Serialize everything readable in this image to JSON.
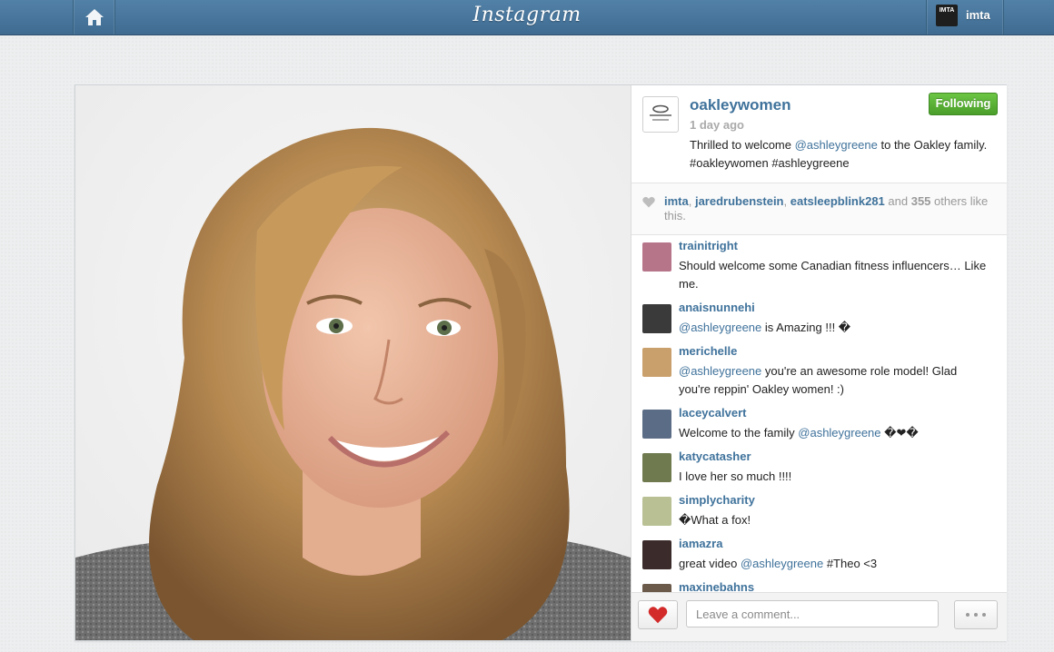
{
  "header": {
    "logo_text": "Instagram",
    "user": {
      "name": "imta",
      "avatar_text": "IMTA"
    },
    "home_icon": "home-icon"
  },
  "post": {
    "owner": {
      "username": "oakleywomen",
      "avatar_text": "oakley women"
    },
    "follow_label": "Following",
    "time_ago": "1 day ago",
    "caption": {
      "before": "Thrilled to welcome ",
      "mention": "@ashleygreene",
      "after": " to the Oakley family. #oakleywomen #ashleygreene"
    },
    "likes": {
      "users": [
        "imta",
        "jaredrubenstein",
        "eatsleepblink281"
      ],
      "sep": ", ",
      "and_text": " and ",
      "count": "355",
      "suffix": " others like this."
    }
  },
  "comments": [
    {
      "user": "trainitright",
      "before": "Should welcome some Canadian fitness influencers… Like me.",
      "mention": "",
      "after": "",
      "avatar_color": "#b7758a"
    },
    {
      "user": "anaisnunnehi",
      "before": "",
      "mention": "@ashleygreene",
      "after": " is Amazing !!! �",
      "avatar_color": "#3a3a3a"
    },
    {
      "user": "merichelle",
      "before": "",
      "mention": "@ashleygreene",
      "after": " you're an awesome role model! Glad you're reppin' Oakley women! :)",
      "avatar_color": "#c99f6b"
    },
    {
      "user": "laceycalvert",
      "before": "Welcome to the family ",
      "mention": "@ashleygreene",
      "after": " �❤�",
      "avatar_color": "#5b6d86"
    },
    {
      "user": "katycatasher",
      "before": "I love her so much !!!!",
      "mention": "",
      "after": "",
      "avatar_color": "#6f7a4f"
    },
    {
      "user": "simplycharity",
      "before": "�What a fox!",
      "mention": "",
      "after": "",
      "avatar_color": "#b8c094"
    },
    {
      "user": "iamazra",
      "before": "great video ",
      "mention": "@ashleygreene",
      "after": " #Theo <3",
      "avatar_color": "#3b2b2b"
    },
    {
      "user": "maxinebahns",
      "before": "",
      "mention": "",
      "after": "",
      "avatar_color": "#6b5a4a"
    }
  ],
  "footer": {
    "comment_placeholder": "Leave a comment...",
    "like_icon": "heart-icon",
    "more_icon": "more-dots-icon"
  },
  "colors": {
    "link": "#3f729b",
    "follow_green": "#4a9e2a",
    "heart_red": "#d32a2a"
  }
}
